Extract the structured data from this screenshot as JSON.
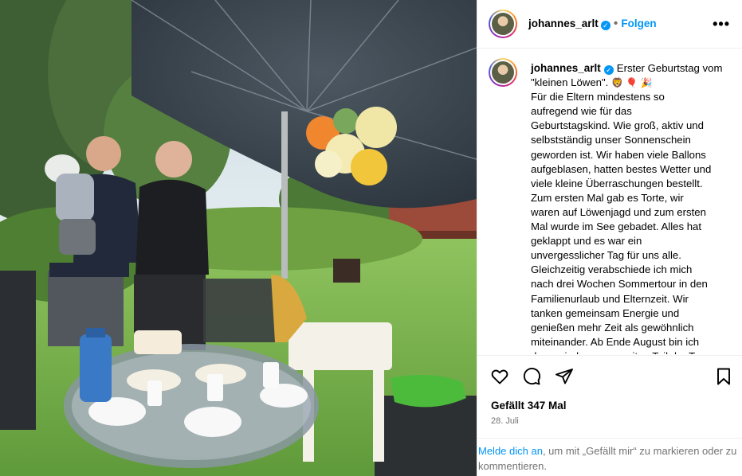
{
  "post": {
    "username": "johannes_arlt",
    "verified_icon": "verified-badge-icon",
    "follow_label": "Folgen",
    "separator": "•",
    "more_icon": "more-options-icon",
    "caption_lines": [
      "Für die Eltern mindestens so",
      "aufregend wie für das",
      "Geburtstagskind. Wie groß, aktiv und",
      "selbstständig unser Sonnenschein",
      "geworden ist. Wir haben viele Ballons",
      "aufgeblasen, hatten bestes Wetter und",
      "viele kleine Überraschungen bestellt.",
      "Zum ersten Mal gab es Torte, wir",
      "waren auf Löwenjagd und zum ersten",
      "Mal wurde im See gebadet. Alles hat",
      "geklappt und es war ein",
      "unvergesslicher Tag für uns alle.",
      "Gleichzeitig verabschiede ich mich",
      "nach drei Wochen Sommertour in den",
      "Familienurlaub und Elternzeit. Wir",
      "tanken gemeinsam Energie und",
      "genießen mehr Zeit als gewöhnlich",
      "miteinander. Ab Ende August bin ich",
      "dann wieder zum zweiten Teil der Tour"
    ],
    "caption_first_line": "Erster Geburtstag vom \"kleinen Löwen\".",
    "caption_emojis": "🦁 🎈 🎉",
    "likes": "Gefällt 347 Mal",
    "date": "28. Juli",
    "login_link": "Melde dich an",
    "login_text": ", um mit „Gefällt mir“ zu markieren oder zu kommentieren."
  },
  "colors": {
    "accent": "#0095f6",
    "muted": "#737373",
    "divider": "#efefef"
  }
}
